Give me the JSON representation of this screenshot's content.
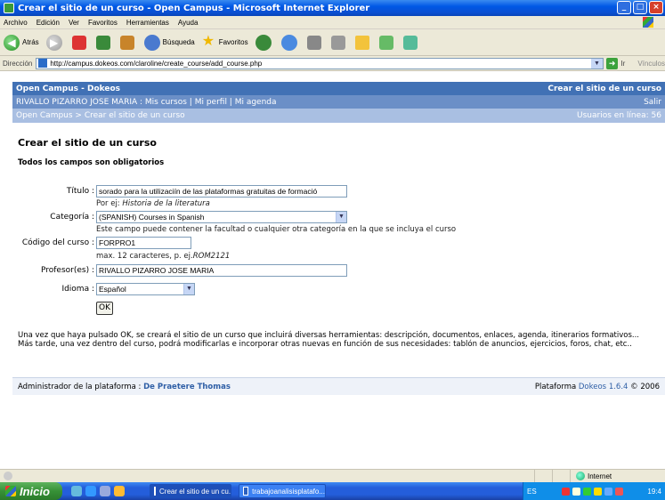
{
  "window": {
    "title": "Crear el sitio de un curso - Open Campus - Microsoft Internet Explorer"
  },
  "menu": [
    "Archivo",
    "Edición",
    "Ver",
    "Favoritos",
    "Herramientas",
    "Ayuda"
  ],
  "toolbar": {
    "back": "Atrás",
    "search": "Búsqueda",
    "favorites": "Favoritos"
  },
  "address": {
    "label": "Dirección",
    "url": "http://campus.dokeos.com/claroline/create_course/add_course.php",
    "go": "Ir",
    "links": "Vínculos"
  },
  "header": {
    "site": "Open Campus - Dokeos",
    "section": "Crear el sitio de un curso",
    "user_links": "RIVALLO PIZARRO JOSE MARIA : Mis cursos | Mi perfil | Mi agenda",
    "logout": "Salir",
    "breadcrumb": "Open Campus > Crear el sitio de un curso",
    "online": "Usuarios en línea: 56"
  },
  "form": {
    "title": "Crear el sitio de un curso",
    "required_note": "Todos los campos son obligatorios",
    "titulo_label": "Título :",
    "titulo_value": "sorado para la utilizaciín de las plataformas gratuitas de formació",
    "titulo_hint": "Por ej:",
    "titulo_hint_example": "Historia de la literatura",
    "categoria_label": "Categoría :",
    "categoria_value": "(SPANISH) Courses in Spanish",
    "categoria_hint": "Este campo puede contener la facultad o cualquier otra categoría en la que se incluya el curso",
    "codigo_label": "Código del curso :",
    "codigo_value": "FORPRO1",
    "codigo_hint": "max. 12 caracteres, p. ej.",
    "codigo_hint_example": "ROM2121",
    "profesor_label": "Profesor(es) :",
    "profesor_value": "RIVALLO PIZARRO JOSE MARIA",
    "idioma_label": "Idioma :",
    "idioma_value": "Español",
    "ok": "OK",
    "description": "Una vez que haya pulsado OK, se creará el sitio de un curso que incluirá diversas herramientas: descripción, documentos, enlaces, agenda, itinerarios formativos... Más tarde, una vez dentro del curso, podrá modificarlas e incorporar otras nuevas en función de sus necesidades: tablón de anuncios, ejercicios, foros, chat, etc.."
  },
  "footer": {
    "admin_label": "Administrador de la plataforma :",
    "admin_name": "De Praetere Thomas",
    "platform_label": "Plataforma",
    "platform_version": "Dokeos 1.6.4",
    "copyright": "© 2006"
  },
  "status": {
    "zone": "Internet"
  },
  "taskbar": {
    "start": "Inicio",
    "task1": "Crear el sitio de un cu...",
    "task2": "trabajoanalisisplatafo...",
    "lang": "ES",
    "clock": "19:4"
  },
  "colors": {
    "header_dark": "#4171b5",
    "header_mid": "#6b8fc7",
    "header_light": "#a9bfe2",
    "link": "#2f5fa6"
  }
}
